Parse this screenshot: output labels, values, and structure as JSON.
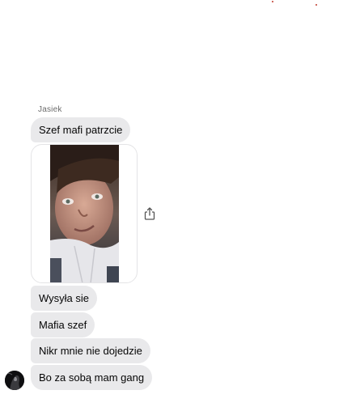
{
  "conversation": {
    "sender_name": "Jasiek",
    "messages": [
      {
        "type": "text",
        "text": "Szef mafi patrzcie"
      },
      {
        "type": "image",
        "icon": "photo-icon"
      },
      {
        "type": "text",
        "text": "Wysyła sie"
      },
      {
        "type": "text",
        "text": "Mafia szef"
      },
      {
        "type": "text",
        "text": "Nikr mnie nie dojedzie"
      },
      {
        "type": "text",
        "text": "Bo za sobą mam gang"
      }
    ]
  },
  "icons": {
    "share": "share-icon",
    "avatar": "sender-avatar"
  },
  "colors": {
    "bubble_bg": "#e9e9eb",
    "text": "#050505",
    "name": "#6b6b6b",
    "background": "#ffffff"
  }
}
